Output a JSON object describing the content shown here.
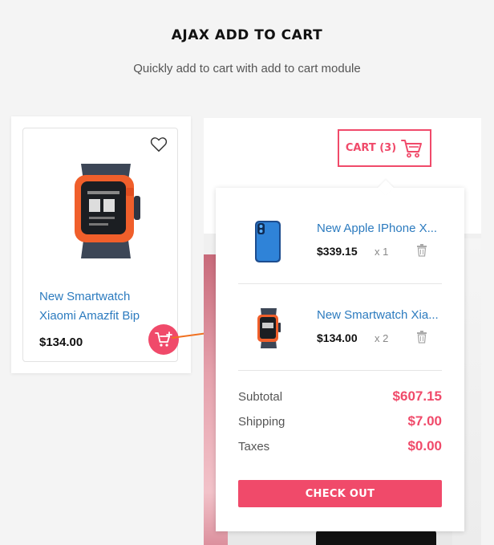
{
  "header": {
    "title": "AJAX ADD TO CART",
    "subtitle": "Quickly add to cart with add to cart module"
  },
  "product": {
    "name": "New Smartwatch Xiaomi Amazfit Bip",
    "price": "$134.00",
    "icons": {
      "wishlist": "heart-icon",
      "add_to_cart": "cart-plus-icon"
    }
  },
  "cart": {
    "button_label": "CART (3)",
    "items": [
      {
        "name": "New Apple IPhone X...",
        "price": "$339.15",
        "qty": "x 1"
      },
      {
        "name": "New Smartwatch Xia...",
        "price": "$134.00",
        "qty": "x 2"
      }
    ],
    "totals": [
      {
        "label": "Subtotal",
        "value": "$607.15"
      },
      {
        "label": "Shipping",
        "value": "$7.00"
      },
      {
        "label": "Taxes",
        "value": "$0.00"
      }
    ],
    "checkout_label": "CHECK OUT"
  },
  "colors": {
    "accent": "#f04a6a",
    "link": "#2c7bbf",
    "arrow": "#f07020"
  }
}
